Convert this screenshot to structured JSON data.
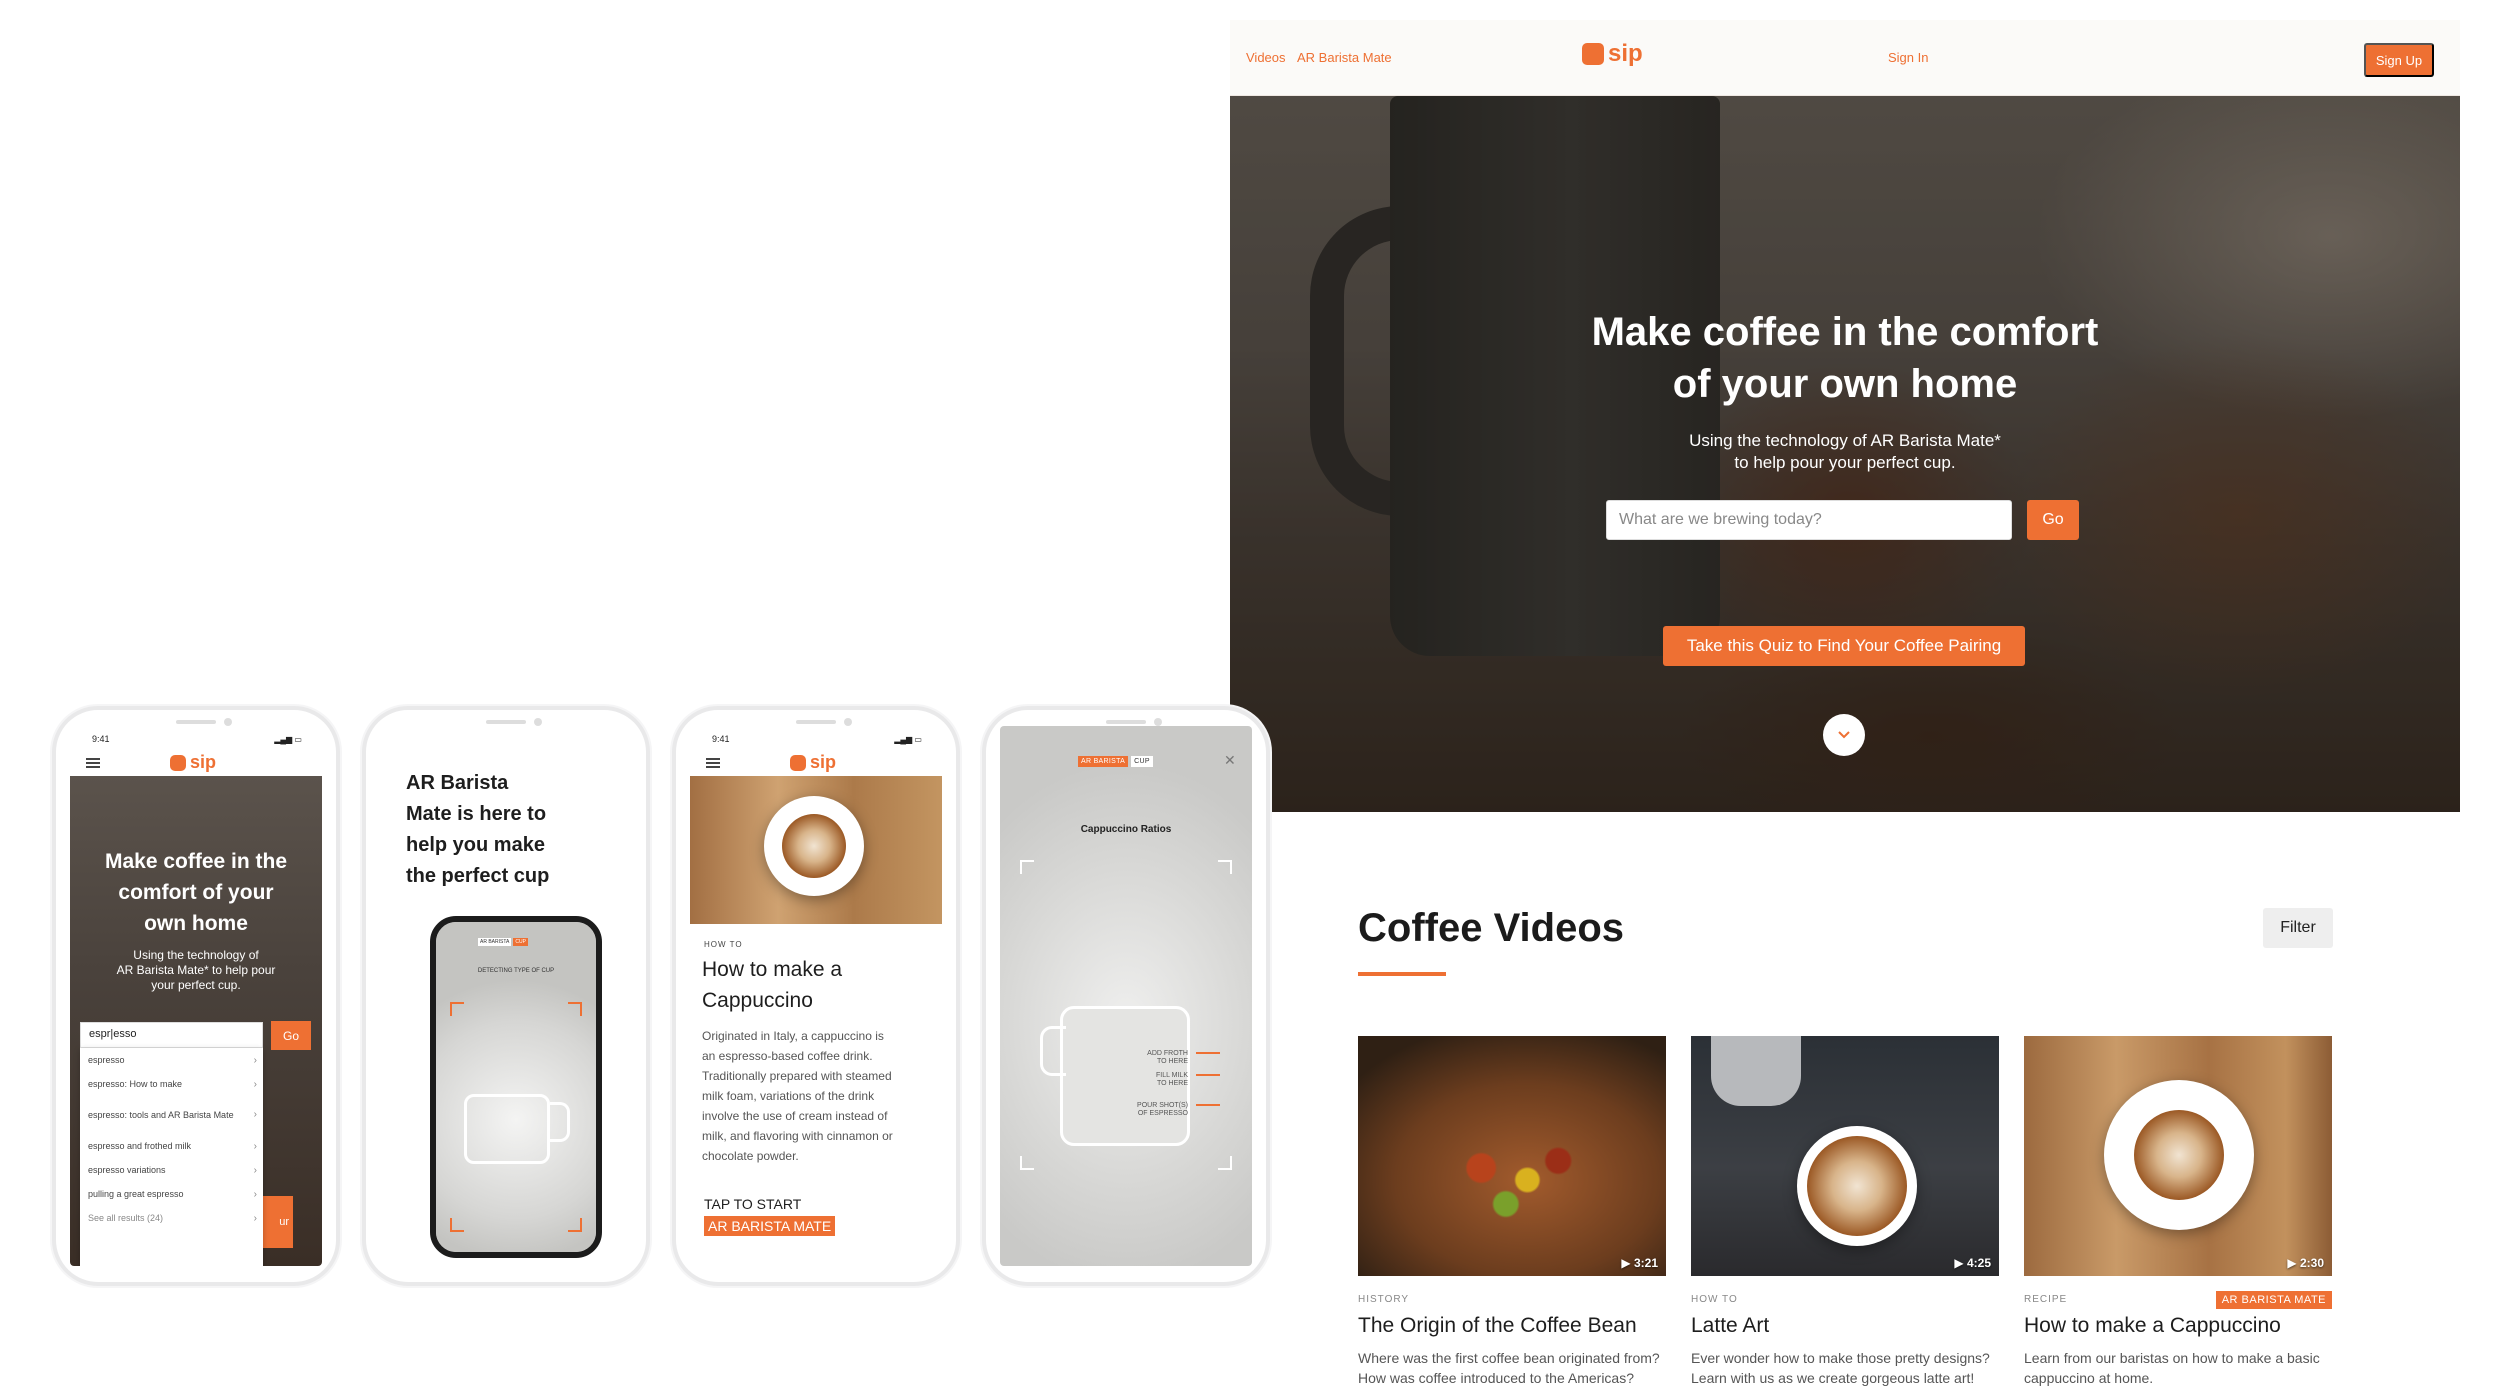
{
  "desktop": {
    "nav": {
      "links": [
        "Videos",
        "AR Barista Mate"
      ],
      "logo": "sip",
      "sign_in": "Sign In",
      "sign_up": "Sign Up"
    },
    "hero": {
      "headline_1": "Make coffee in the comfort",
      "headline_2": "of your own home",
      "subtitle_1": "Using the technology of AR Barista Mate*",
      "subtitle_2": "to help pour your perfect cup.",
      "search_placeholder": "What are we brewing today?",
      "go_label": "Go",
      "quiz_label": "Take this Quiz to Find Your Coffee Pairing",
      "scroll_icon": "chevron-down-icon"
    },
    "videos": {
      "title": "Coffee Videos",
      "filter_label": "Filter",
      "cards": [
        {
          "category": "HISTORY",
          "duration": "3:21",
          "title": "The Origin of the Coffee Bean",
          "desc_1": "Where was the first coffee bean originated from?",
          "desc_2": "How was coffee introduced to the Americas?",
          "badge": ""
        },
        {
          "category": "HOW TO",
          "duration": "4:25",
          "title": "Latte Art",
          "desc_1": "Ever wonder how to make those pretty designs?",
          "desc_2": "Learn with us as we create gorgeous latte art!",
          "badge": ""
        },
        {
          "category": "RECIPE",
          "duration": "2:30",
          "title": "How to make a Cappuccino",
          "desc_1": "Learn from our baristas on how to make a basic",
          "desc_2": "cappuccino at home.",
          "badge": "AR BARISTA MATE"
        }
      ]
    }
  },
  "mobile": {
    "time": "9:41",
    "phone1": {
      "logo": "sip",
      "headline_1": "Make coffee in the",
      "headline_2": "comfort of your",
      "headline_3": "own home",
      "subtitle_1": "Using the technology of",
      "subtitle_2": "AR Barista Mate* to help pour",
      "subtitle_3": "your perfect cup.",
      "search_value": "espr|esso",
      "go_label": "Go",
      "suggestions": [
        "espresso",
        "espresso: How to make",
        "espresso: tools and AR Barista Mate",
        "espresso and frothed milk",
        "espresso variations",
        "pulling a great espresso",
        "See all results (24)"
      ],
      "partial_button": "ur"
    },
    "phone2": {
      "headline_1": "AR Barista",
      "headline_2": "Mate is here to",
      "headline_3": "help you make",
      "headline_4": "the perfect cup",
      "tag_ar": "AR BARISTA",
      "tag_cup": "CUP",
      "detecting": "DETECTING TYPE OF CUP"
    },
    "phone3": {
      "logo": "sip",
      "label": "HOW TO",
      "title_1": "How to make a",
      "title_2": "Cappuccino",
      "body": [
        "Originated in Italy, a cappuccino is",
        "an espresso-based coffee drink.",
        "Traditionally prepared with steamed",
        "milk foam, variations of the drink",
        "involve the use of cream instead of",
        "milk, and flavoring with cinnamon or",
        "chocolate powder."
      ],
      "tap": "TAP TO START",
      "ar": "AR BARISTA MATE"
    },
    "phone4": {
      "tag_ar": "AR BARISTA",
      "tag_cup": "CUP",
      "close_icon": "close-icon",
      "title": "Cappuccino Ratios",
      "guide_1a": "ADD FROTH",
      "guide_1b": "TO HERE",
      "guide_2a": "FILL MILK",
      "guide_2b": "TO HERE",
      "guide_3a": "POUR SHOT(S)",
      "guide_3b": "OF ESPRESSO"
    }
  },
  "colors": {
    "accent": "#ee7033",
    "filter_bg": "#eeeeee"
  }
}
